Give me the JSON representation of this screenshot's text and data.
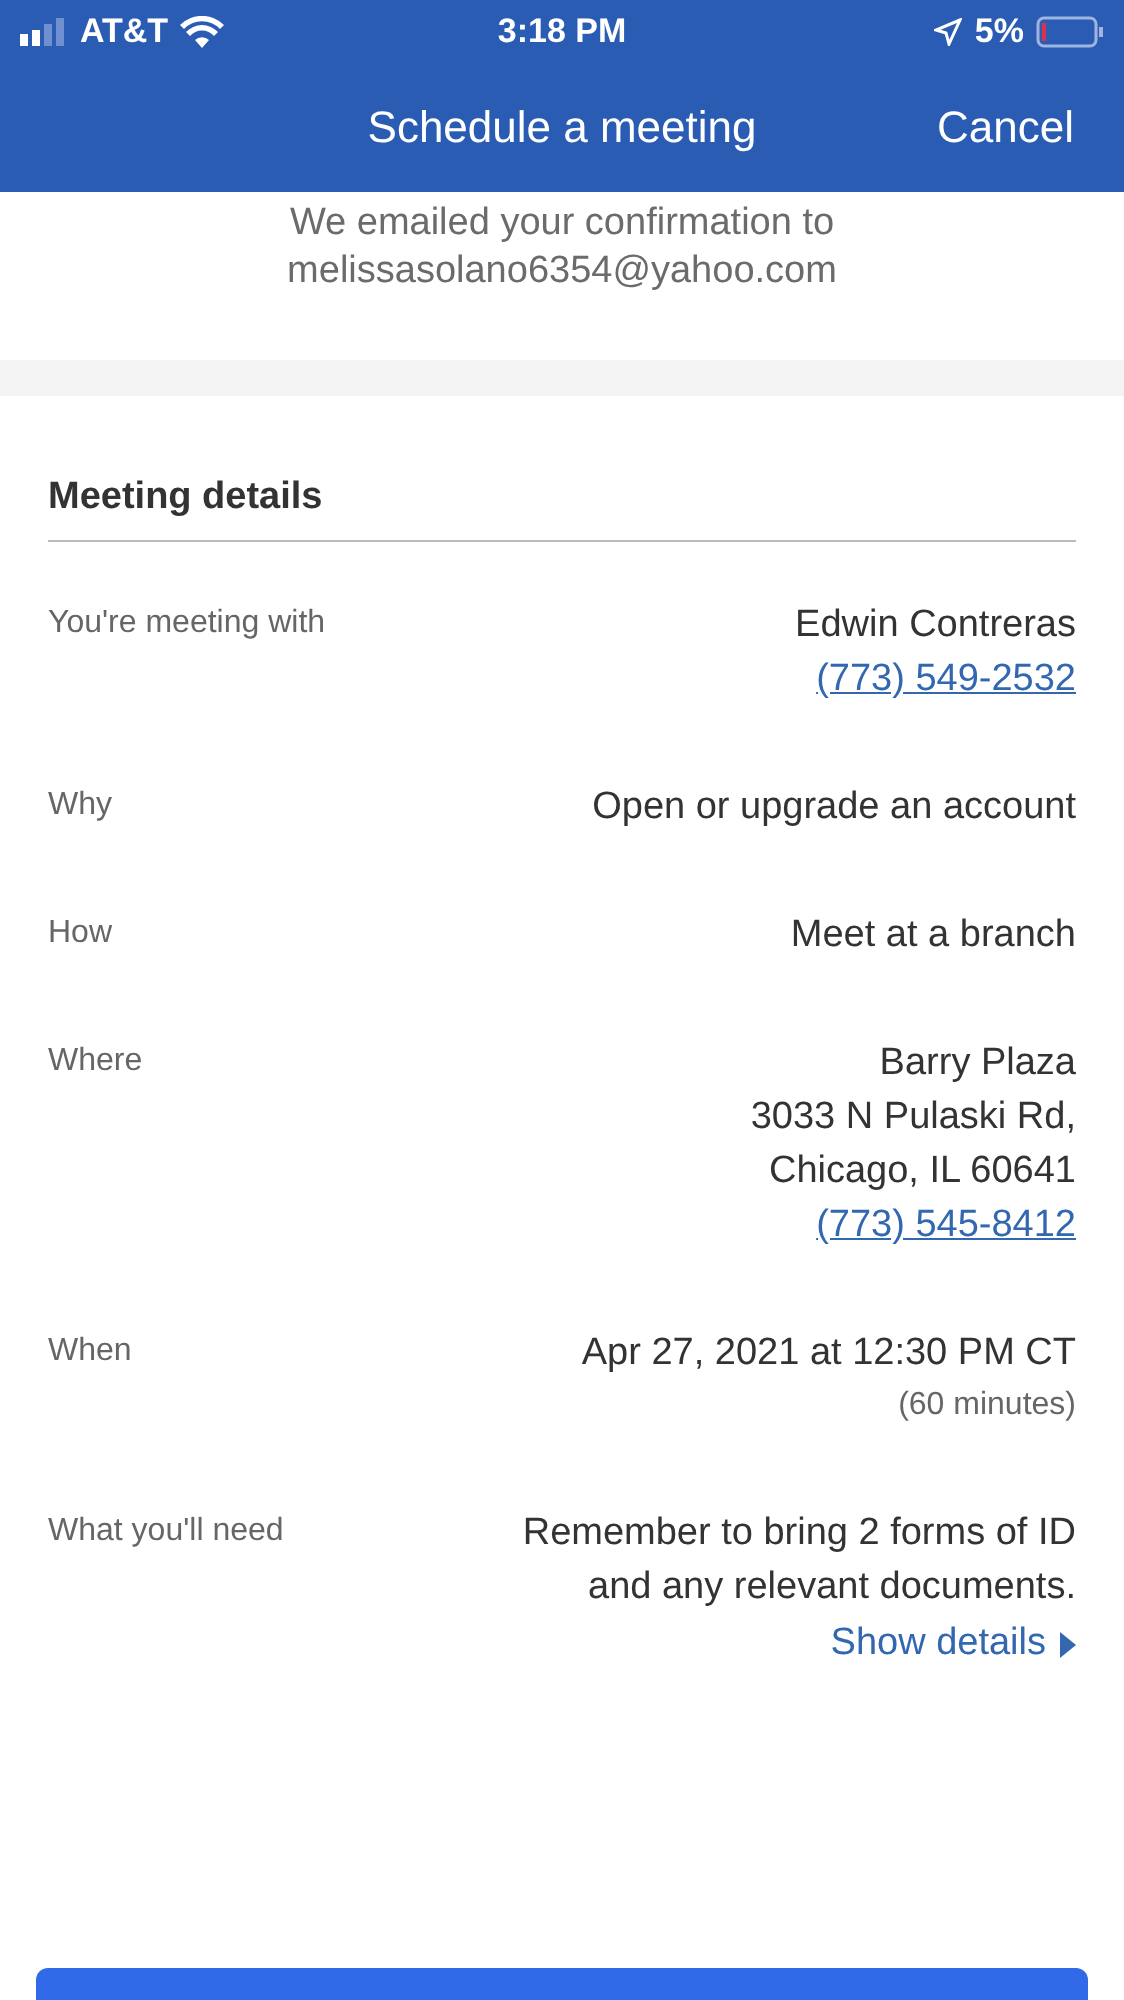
{
  "status_bar": {
    "carrier": "AT&T",
    "time": "3:18 PM",
    "battery": "5%"
  },
  "header": {
    "title": "Schedule a meeting",
    "cancel": "Cancel"
  },
  "confirmation": {
    "lines": [
      "We emailed your confirmation to",
      "melissasolano6354@yahoo.com"
    ]
  },
  "section": {
    "title": "Meeting details"
  },
  "rows": [
    {
      "label": "You're meeting with",
      "lines": [
        {
          "kind": "text",
          "text": "Edwin Contreras"
        },
        {
          "kind": "link",
          "text": "(773) 549-2532"
        }
      ]
    },
    {
      "label": "Why",
      "lines": [
        {
          "kind": "text",
          "text": "Open or upgrade an account"
        }
      ]
    },
    {
      "label": "How",
      "lines": [
        {
          "kind": "text",
          "text": "Meet at a branch"
        }
      ]
    },
    {
      "label": "Where",
      "lines": [
        {
          "kind": "text",
          "text": "Barry Plaza"
        },
        {
          "kind": "text",
          "text": "3033 N Pulaski Rd,"
        },
        {
          "kind": "text",
          "text": "Chicago, IL 60641"
        },
        {
          "kind": "link",
          "text": "(773) 545-8412"
        }
      ]
    },
    {
      "label": "When",
      "lines": [
        {
          "kind": "text",
          "text": "Apr 27, 2021 at 12:30 PM CT"
        },
        {
          "kind": "note",
          "text": "(60 minutes)"
        }
      ]
    },
    {
      "label": "What you'll need",
      "lines": [
        {
          "kind": "text",
          "text": "Remember to bring 2 forms of ID and any relevant documents."
        },
        {
          "kind": "toggle",
          "text": "Show details"
        }
      ]
    }
  ]
}
